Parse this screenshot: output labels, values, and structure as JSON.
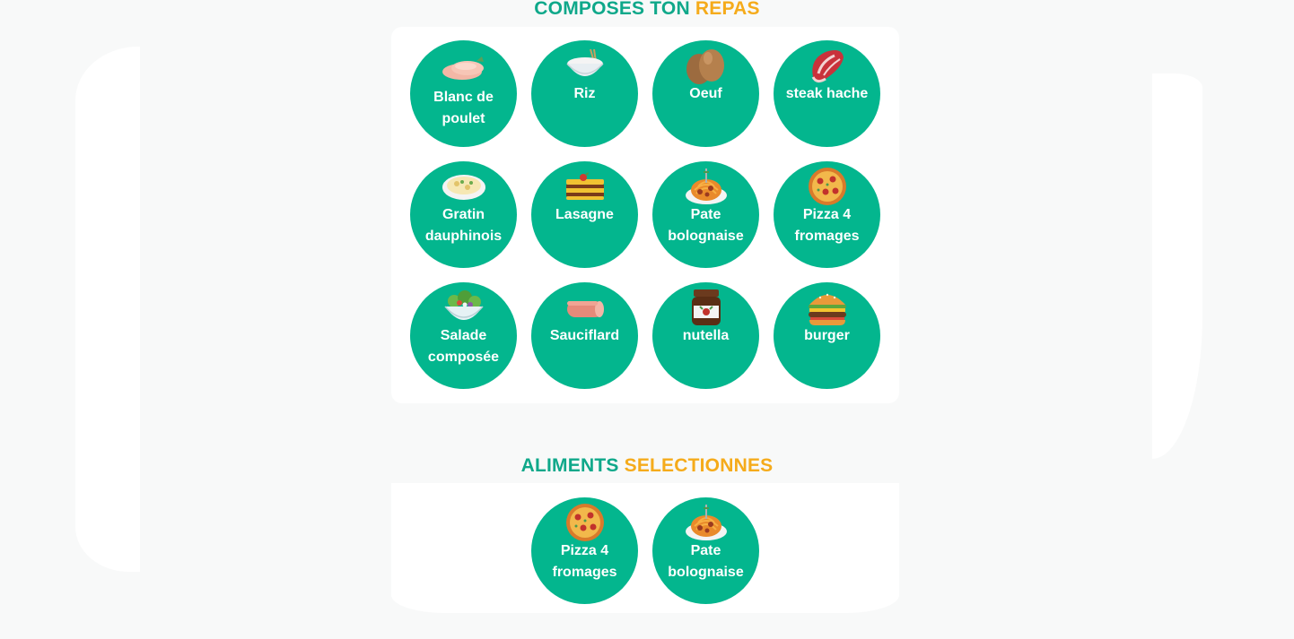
{
  "header": {
    "title_part1": "COMPOSES TON",
    "title_part2": "REPAS"
  },
  "menu": {
    "items": [
      {
        "label": "Blanc de poulet",
        "icon": "chicken-breast-icon"
      },
      {
        "label": "Riz",
        "icon": "rice-bowl-icon"
      },
      {
        "label": "Oeuf",
        "icon": "eggs-icon"
      },
      {
        "label": "steak hache",
        "icon": "steak-icon"
      },
      {
        "label": "Gratin dauphinois",
        "icon": "gratin-icon"
      },
      {
        "label": "Lasagne",
        "icon": "lasagna-icon"
      },
      {
        "label": "Pate bolognaise",
        "icon": "spaghetti-icon"
      },
      {
        "label": "Pizza 4 fromages",
        "icon": "pizza-icon"
      },
      {
        "label": "Salade composée",
        "icon": "salad-icon"
      },
      {
        "label": "Sauciflard",
        "icon": "sausage-icon"
      },
      {
        "label": "nutella",
        "icon": "nutella-jar-icon"
      },
      {
        "label": "burger",
        "icon": "burger-icon"
      }
    ]
  },
  "selected_header": {
    "title_part1": "ALIMENTS",
    "title_part2": "SELECTIONNES"
  },
  "selected": {
    "items": [
      {
        "label": "Pizza 4 fromages",
        "icon": "pizza-icon"
      },
      {
        "label": "Pate bolognaise",
        "icon": "spaghetti-icon"
      }
    ]
  },
  "colors": {
    "accent_green": "#03b68e",
    "title_green": "#0fa88a",
    "title_orange": "#f5ab1b"
  }
}
